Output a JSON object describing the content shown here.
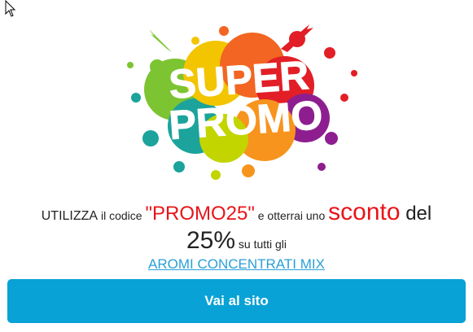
{
  "promo_image": {
    "title_line1": "SUPER",
    "title_line2": "PROMO"
  },
  "promo_text": {
    "part1": "UTILIZZA",
    "part2": " il codice ",
    "code": "\"PROMO25\"",
    "part3": " e otterrai uno ",
    "discount_word": "sconto",
    "part4": " del",
    "percent": "25%",
    "part5": " su tutti gli",
    "link_label": "AROMI CONCENTRATI MIX"
  },
  "cta": {
    "label": "Vai al sito"
  },
  "colors": {
    "accent_blue": "#08a2d6",
    "promo_red": "#e8141a",
    "link_blue": "#2a9fd6"
  },
  "icons": {
    "cursor": "mouse-pointer-icon"
  }
}
